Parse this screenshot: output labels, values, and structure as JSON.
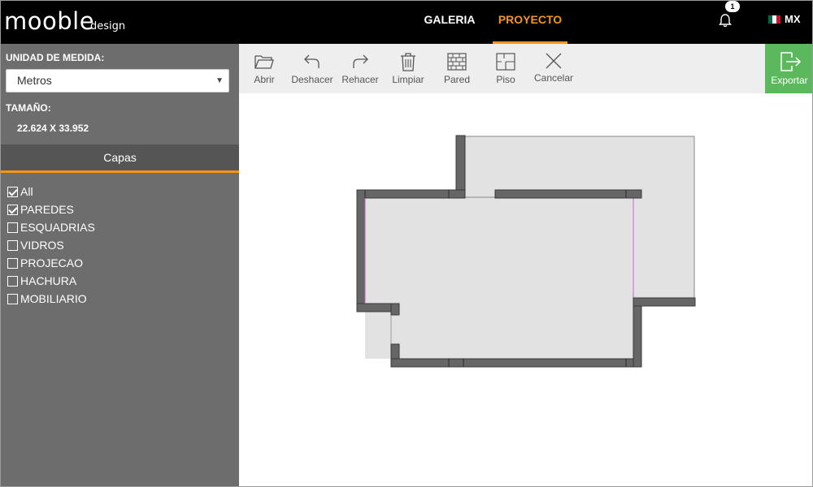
{
  "header": {
    "logo_main": "mooble",
    "logo_sub": "design",
    "nav": [
      {
        "label": "GALERIA"
      },
      {
        "label": "PROYECTO",
        "active": true
      }
    ],
    "notification_count": "1",
    "country": "MX",
    "accent_color": "#f7941d"
  },
  "sidebar": {
    "unit_label": "UNIDAD DE MEDIDA:",
    "unit_value": "Metros",
    "size_label": "TAMAÑO:",
    "size_value": "22.624 X 33.952",
    "layers_title": "Capas",
    "layers": [
      {
        "label": "All",
        "checked": true
      },
      {
        "label": "PAREDES",
        "checked": true
      },
      {
        "label": "ESQUADRIAS",
        "checked": false
      },
      {
        "label": "VIDROS",
        "checked": false
      },
      {
        "label": "PROJECAO",
        "checked": false
      },
      {
        "label": "HACHURA",
        "checked": false
      },
      {
        "label": "MOBILIARIO",
        "checked": false
      }
    ]
  },
  "toolbar": {
    "open": "Abrir",
    "undo": "Deshacer",
    "redo": "Rehacer",
    "clear": "Limpiar",
    "wall": "Pared",
    "floor": "Piso",
    "cancel": "Cancelar",
    "export": "Exportar",
    "export_color": "#5cb85c"
  }
}
